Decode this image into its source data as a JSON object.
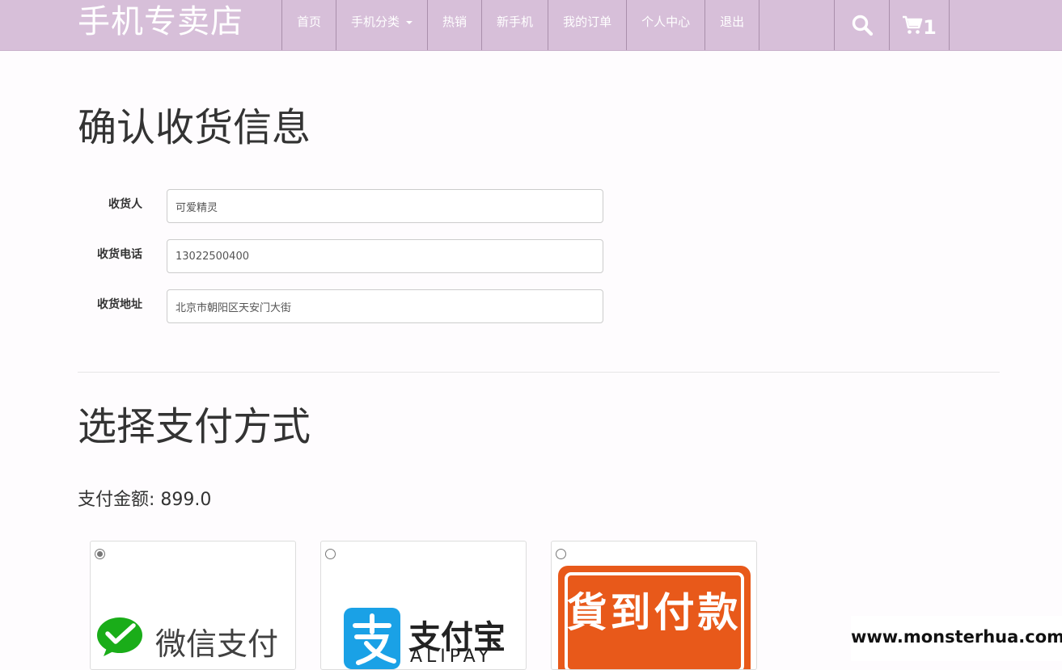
{
  "header": {
    "brand": "手机专卖店",
    "nav": [
      {
        "label": "首页",
        "name": "nav-home"
      },
      {
        "label": "手机分类",
        "name": "nav-category",
        "dropdown": true
      },
      {
        "label": "热销",
        "name": "nav-hot"
      },
      {
        "label": "新手机",
        "name": "nav-new"
      },
      {
        "label": "我的订单",
        "name": "nav-orders"
      },
      {
        "label": "个人中心",
        "name": "nav-profile"
      },
      {
        "label": "退出",
        "name": "nav-logout"
      }
    ],
    "search_icon": "search-icon",
    "cart_icon": "cart-icon",
    "cart_count": "1"
  },
  "confirm": {
    "title": "确认收货信息",
    "fields": [
      {
        "label": "收货人",
        "value": "可爱精灵"
      },
      {
        "label": "收货电话",
        "value": "13022500400"
      },
      {
        "label": "收货地址",
        "value": "北京市朝阳区天安门大街"
      }
    ]
  },
  "payment": {
    "title": "选择支付方式",
    "amount_text": "支付金额: 899.0",
    "options": [
      {
        "label": "微信支付",
        "selected": true,
        "icon": "wechat-pay-icon"
      },
      {
        "label": "支付宝",
        "sublabel": "ALIPAY",
        "selected": false,
        "icon": "alipay-icon"
      },
      {
        "label": "貨到付款",
        "selected": false,
        "icon": "cash-on-delivery-icon"
      }
    ]
  },
  "watermark": "www.monsterhua.com",
  "colors": {
    "navbar": "#d7bfd9",
    "wechat_green": "#1aad19",
    "alipay_blue": "#1aa1e6",
    "cod_orange": "#e8591a"
  }
}
